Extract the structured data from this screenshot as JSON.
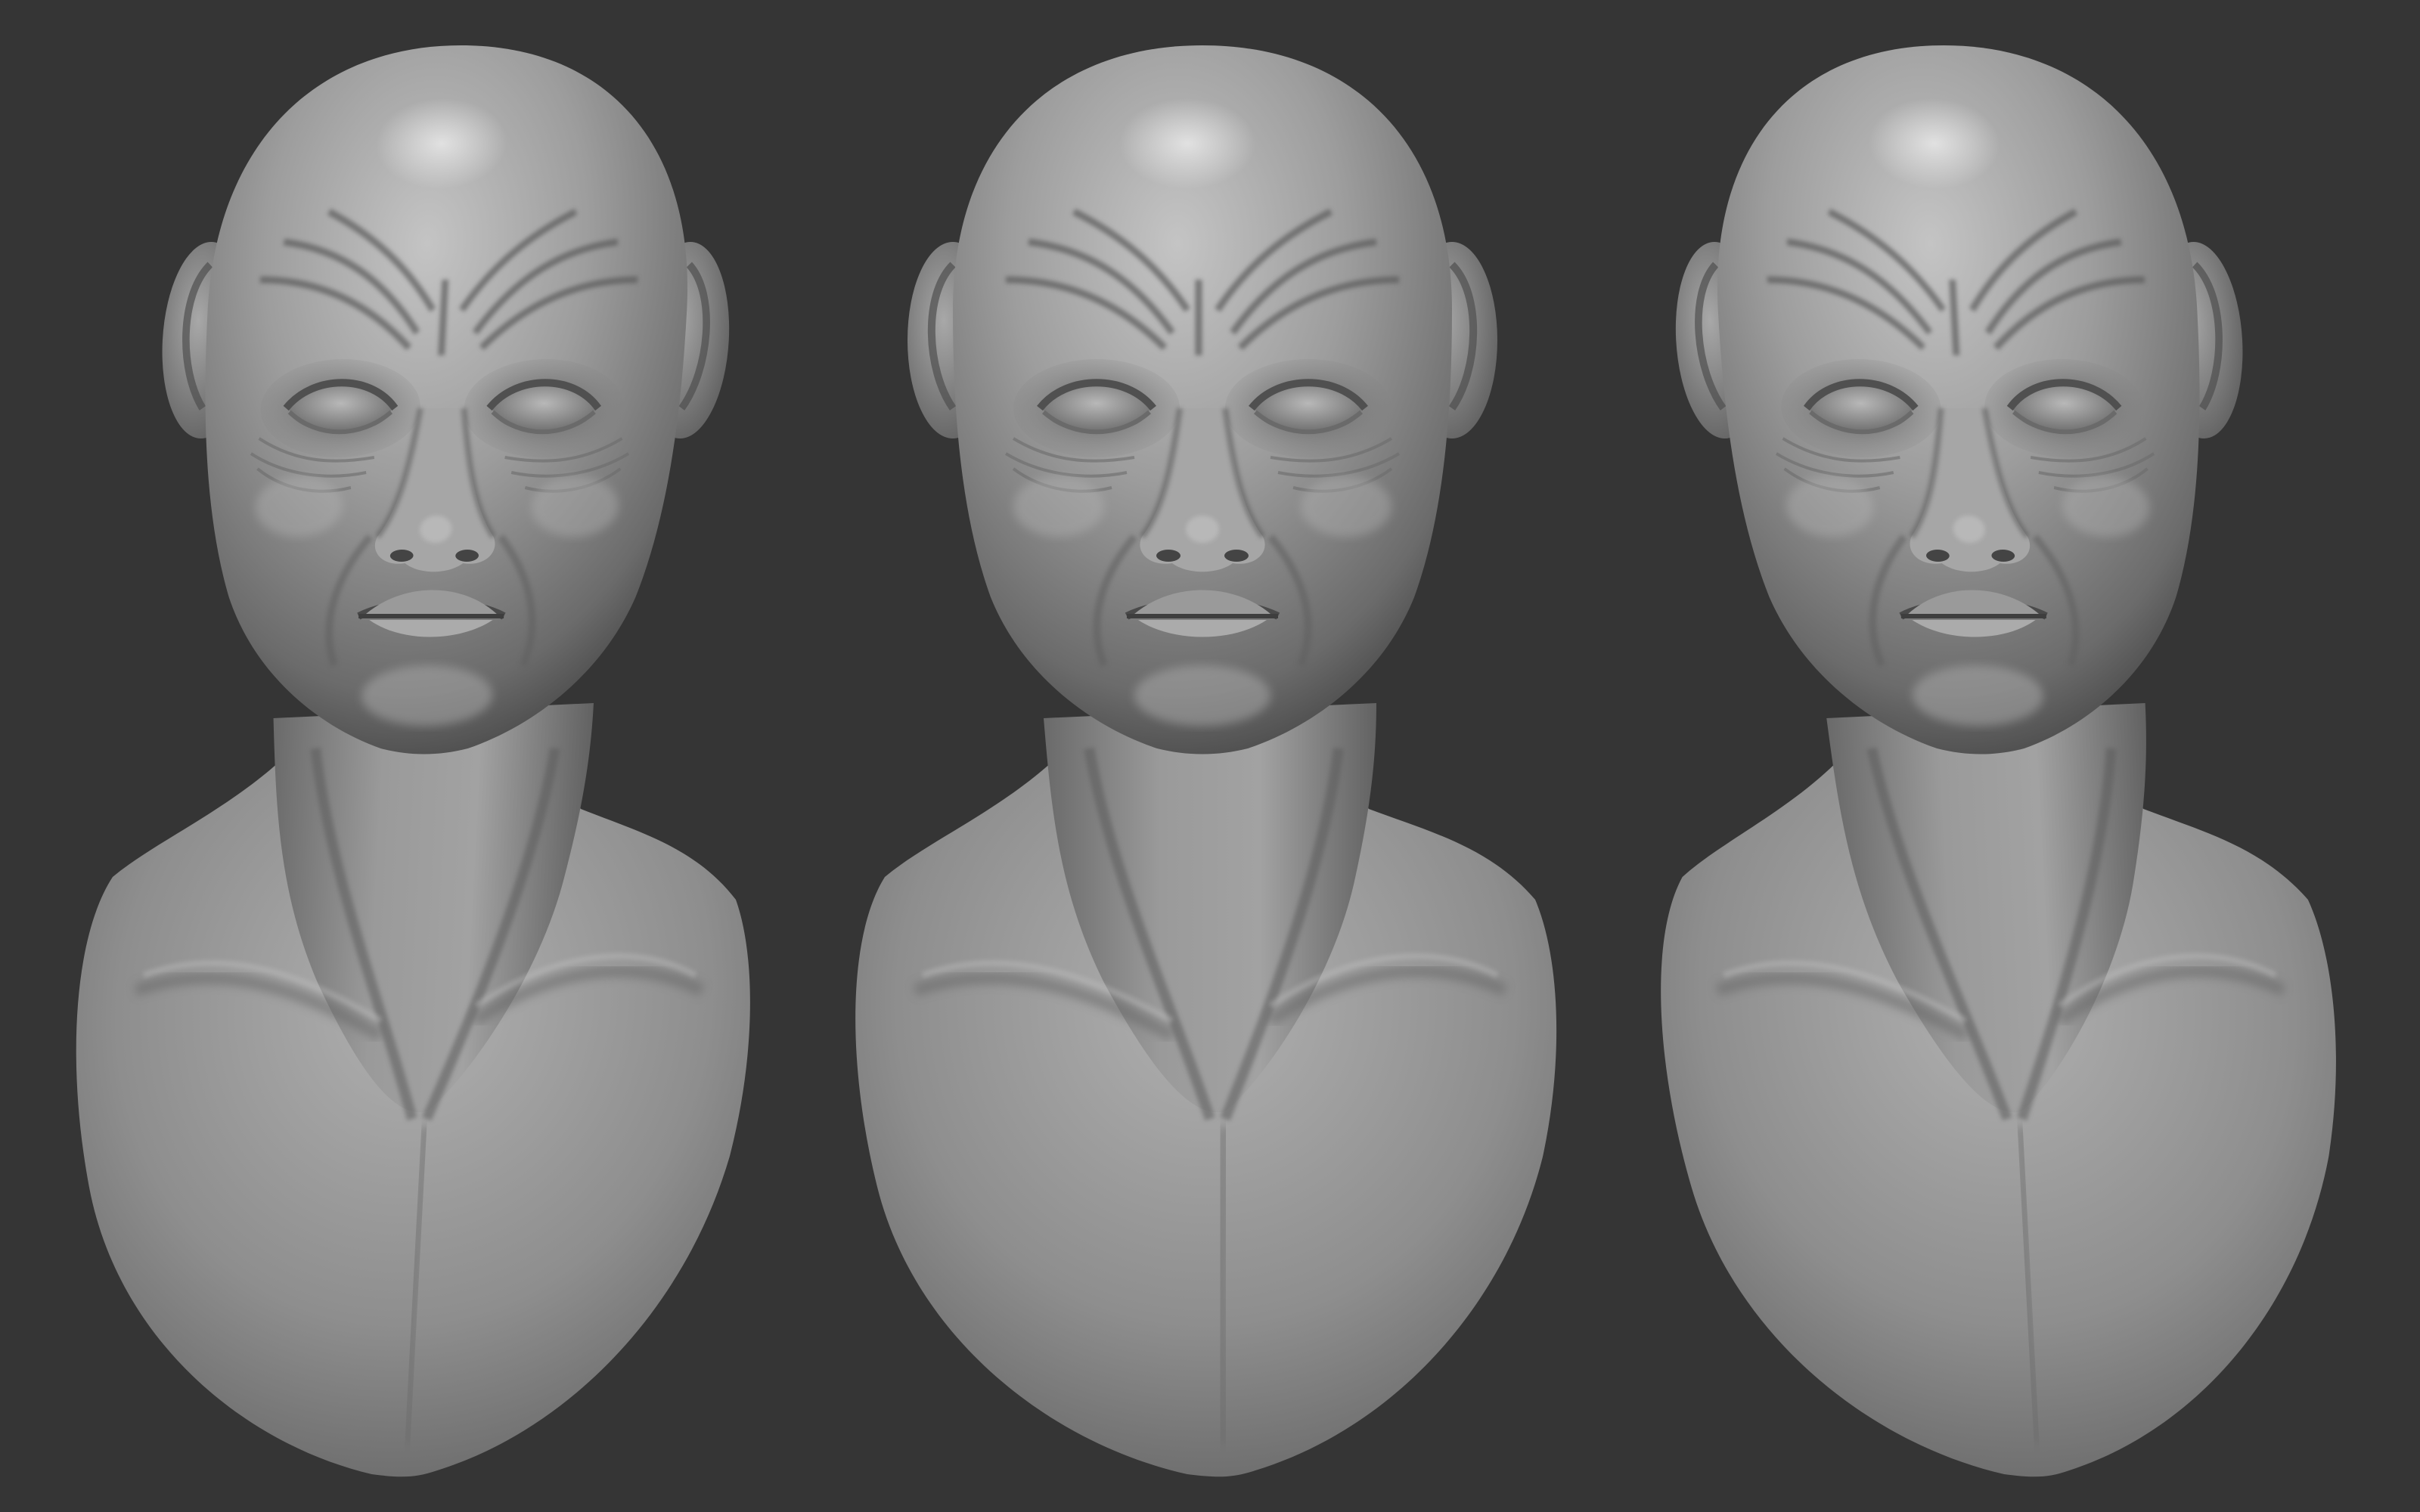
{
  "scene": {
    "background_color": "#353535",
    "material_color": "#9a9a9a",
    "busts": [
      {
        "view": "three-quarter-left"
      },
      {
        "view": "front"
      },
      {
        "view": "three-quarter-right"
      }
    ]
  }
}
